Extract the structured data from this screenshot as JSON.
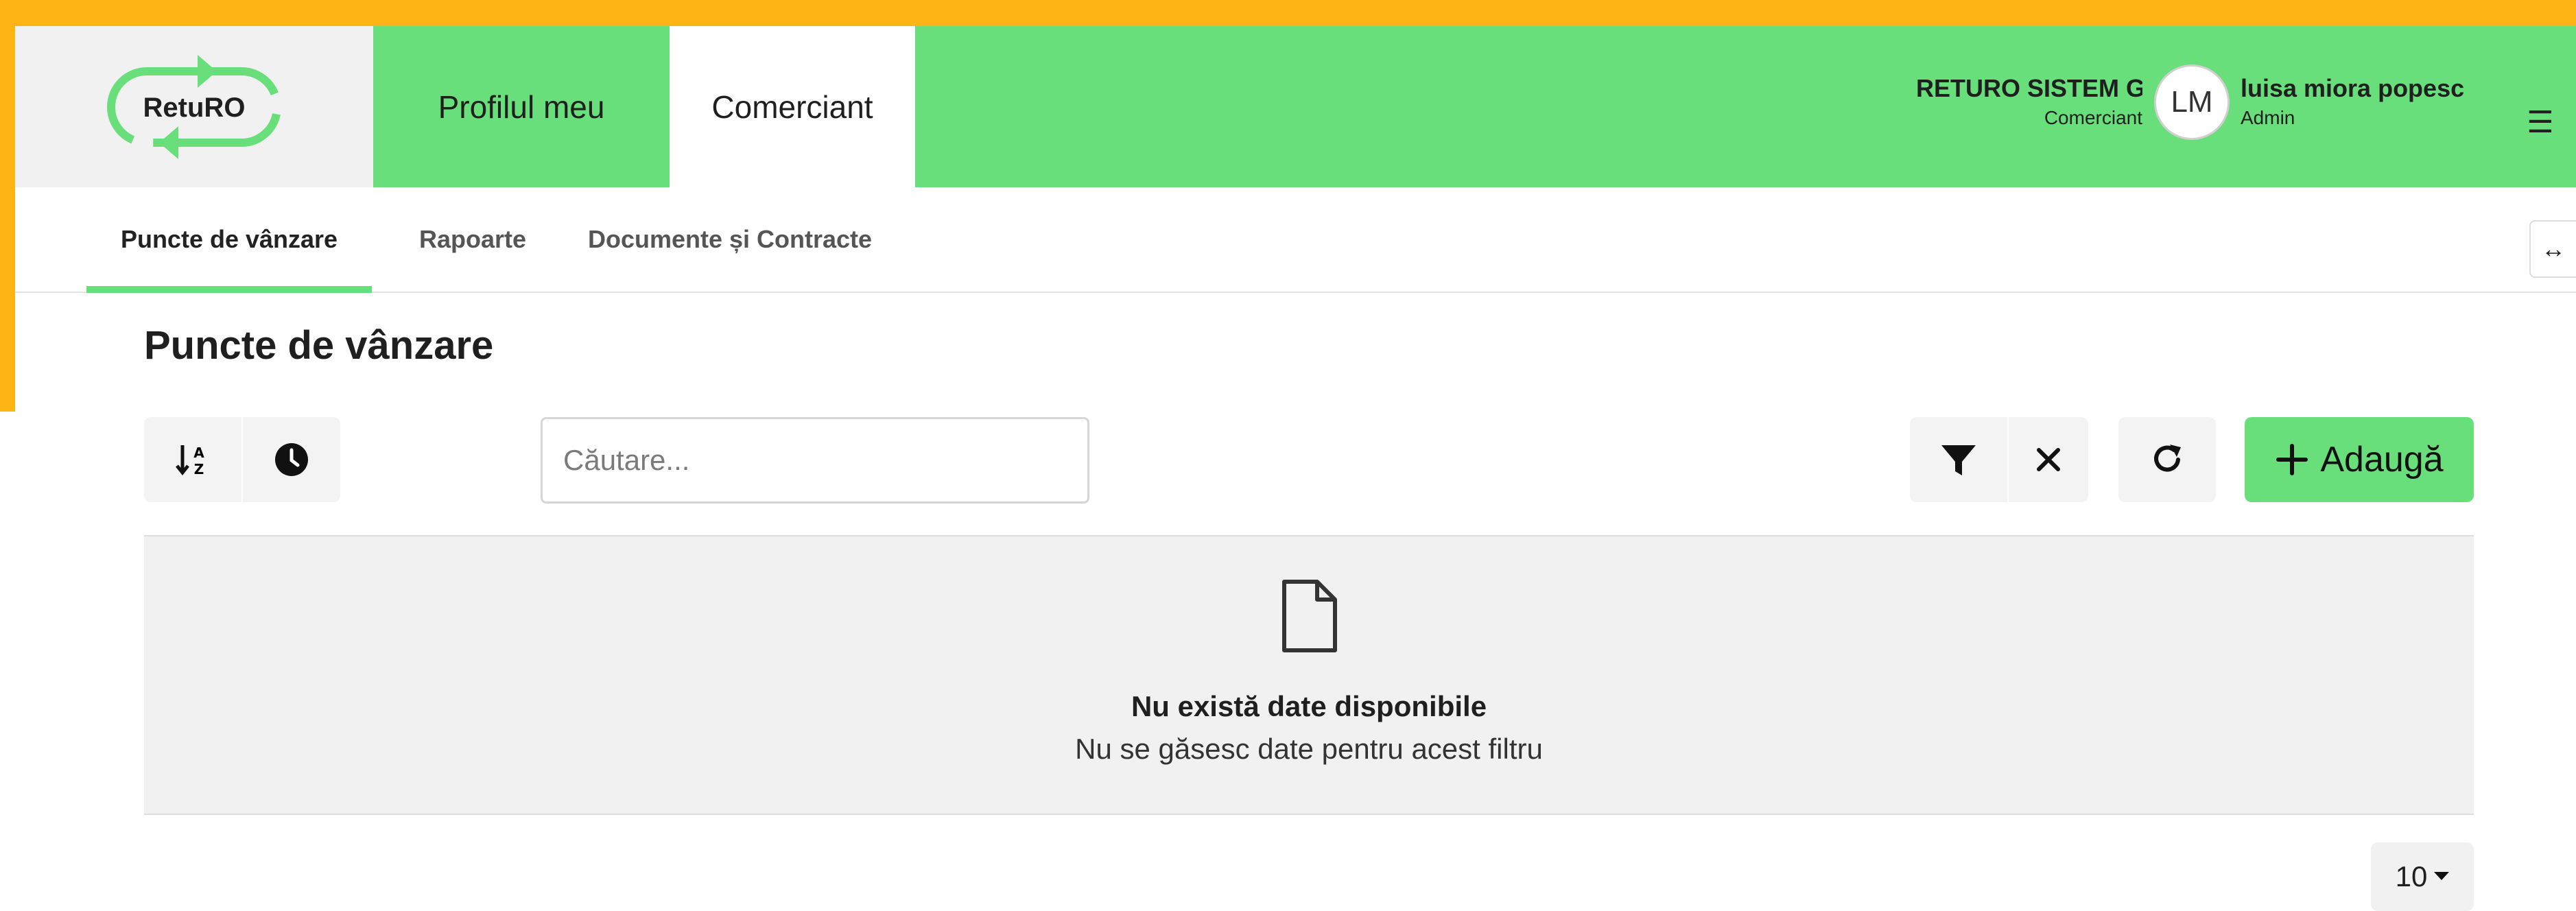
{
  "colors": {
    "accent_yellow": "#FDB515",
    "brand_green": "#69DF7B"
  },
  "header": {
    "logo_text": "RetuRO",
    "tabs": [
      {
        "label": "Profilul meu",
        "active": false
      },
      {
        "label": "Comerciant",
        "active": true
      }
    ],
    "company": {
      "name": "RETURO SISTEM G",
      "role": "Comerciant"
    },
    "user": {
      "initials": "LM",
      "name": "luisa miora popesc",
      "role": "Admin"
    },
    "menu_icon": "hamburger-icon"
  },
  "subnav": {
    "tabs": [
      {
        "label": "Puncte de vânzare",
        "active": true
      },
      {
        "label": "Rapoarte",
        "active": false
      },
      {
        "label": "Documente și Contracte",
        "active": false
      }
    ],
    "expand_icon": "↔"
  },
  "page": {
    "title": "Puncte de vânzare",
    "search_placeholder": "Căutare...",
    "add_label": "Adaugă",
    "empty": {
      "title": "Nu există date disponibile",
      "subtitle": "Nu se găsesc date pentru acest filtru"
    },
    "page_size": "10"
  }
}
